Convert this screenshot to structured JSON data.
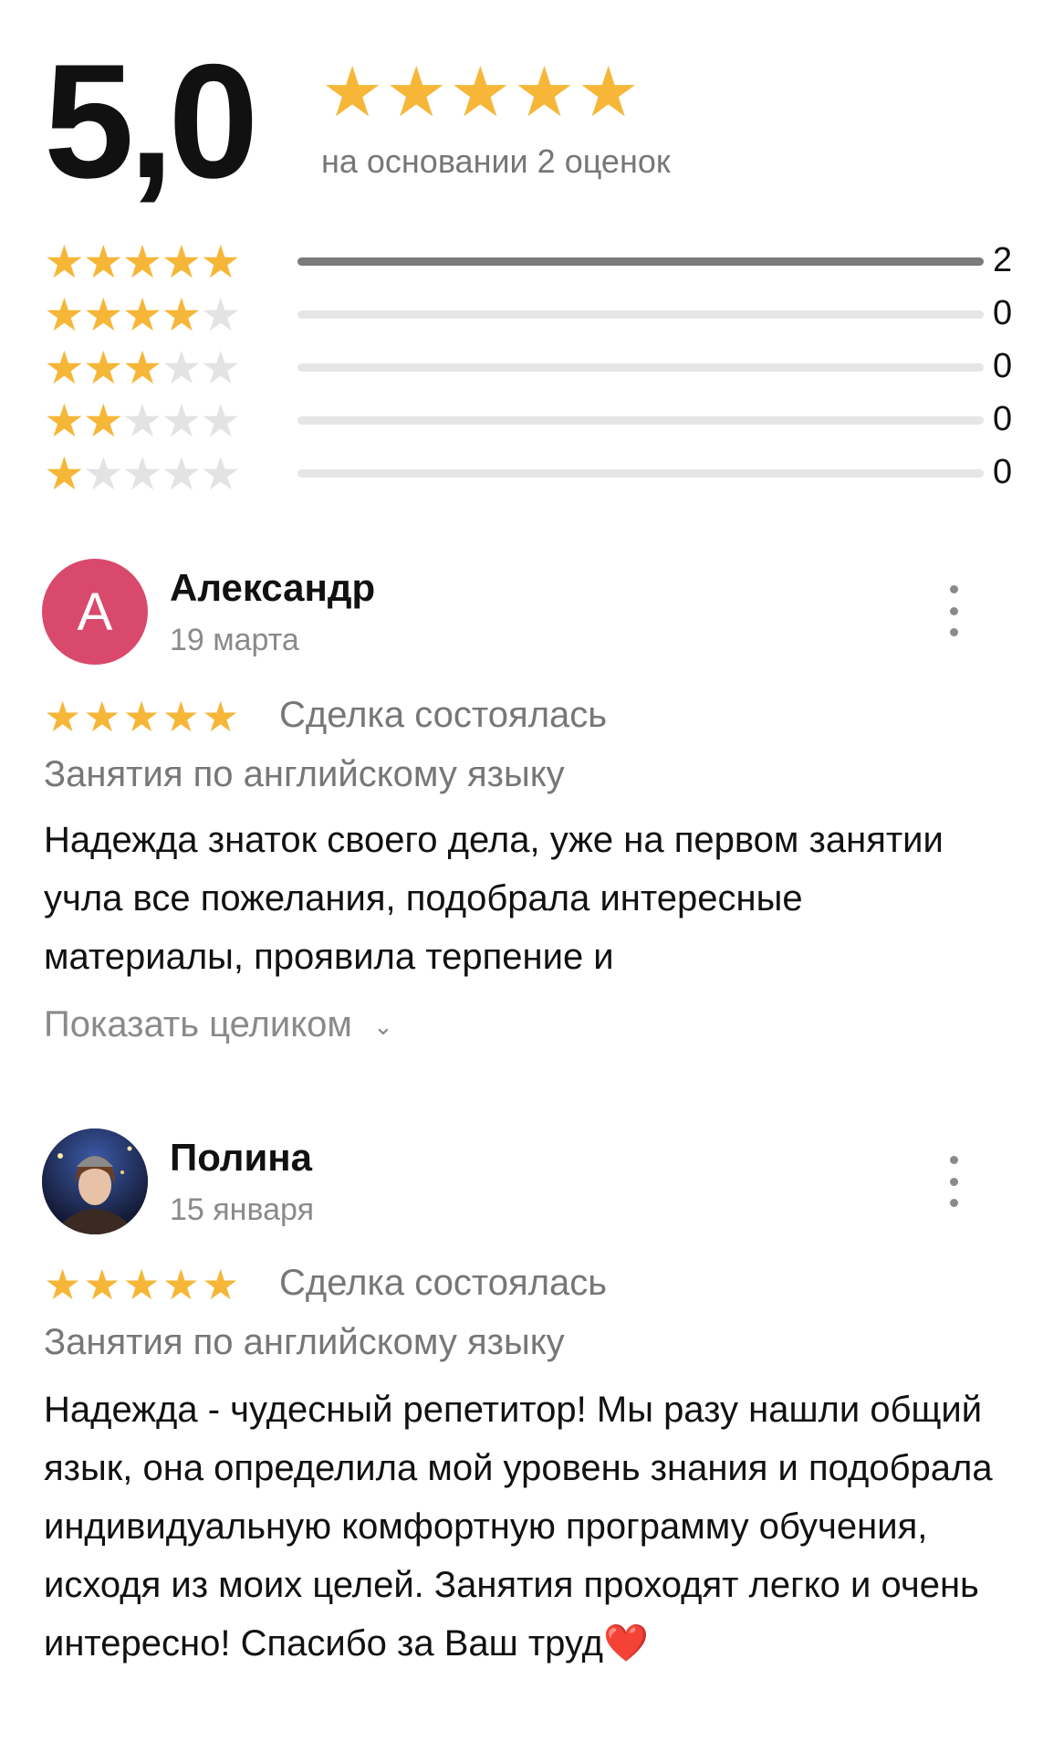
{
  "summary": {
    "score": "5,0",
    "stars": 5,
    "caption": "на основании 2 оценок"
  },
  "distribution": [
    {
      "stars": 5,
      "count": "2",
      "fraction": 1.0
    },
    {
      "stars": 4,
      "count": "0",
      "fraction": 0.0
    },
    {
      "stars": 3,
      "count": "0",
      "fraction": 0.0
    },
    {
      "stars": 2,
      "count": "0",
      "fraction": 0.0
    },
    {
      "stars": 1,
      "count": "0",
      "fraction": 0.0
    }
  ],
  "reviews": [
    {
      "avatar_letter": "А",
      "avatar_color": "#d9496b",
      "name": "Александр",
      "date": "19 марта",
      "stars": 5,
      "status": "Сделка состоялась",
      "service": "Занятия по английскому языку",
      "text": "Надежда знаток своего дела, уже на первом занятии учла все пожелания, подобрала интересные материалы, проявила терпение и",
      "show_more": "Показать целиком"
    },
    {
      "avatar_letter": "",
      "avatar_color": "#1d2440",
      "name": "Полина",
      "date": "15 января",
      "stars": 5,
      "status": "Сделка состоялась",
      "service": "Занятия по английскому языку",
      "text": "Надежда - чудесный репетитор! Мы разу нашли общий язык, она определила мой уровень знания и подобрала  индивидуальную комфортную программу обучения, исходя из моих целей. Занятия проходят легко и очень интересно! Спасибо за Ваш труд",
      "text_emoji": "❤️"
    }
  ],
  "colors": {
    "star_on": "#f6b637",
    "star_off": "#e3e3e3",
    "bar_fill": "#7a7a7a",
    "bar_track": "#e6e6e6"
  }
}
